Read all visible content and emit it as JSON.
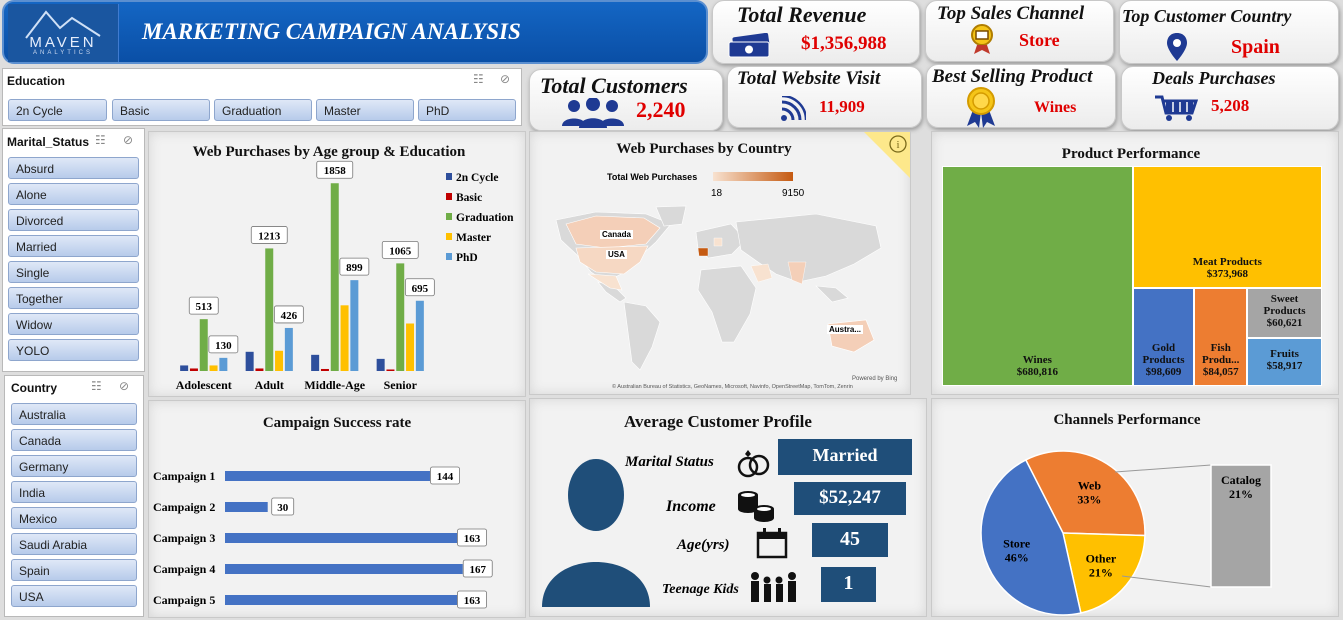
{
  "header": {
    "logo_text": "MAVEN",
    "logo_sub": "ANALYTICS",
    "title": "MARKETING CAMPAIGN ANALYSIS"
  },
  "kpis": {
    "total_revenue": {
      "label": "Total Revenue",
      "value": "$1,356,988",
      "icon": "money-icon"
    },
    "top_sales_channel": {
      "label": "Top Sales Channel",
      "value": "Store",
      "icon": "store-icon"
    },
    "top_customer_country": {
      "label": "Top Customer Country",
      "value": "Spain",
      "icon": "location-pin-icon"
    },
    "total_customers": {
      "label": "Total Customers",
      "value": "2,240",
      "icon": "people-icon"
    },
    "total_website_visit": {
      "label": "Total Website Visit",
      "value": "11,909",
      "icon": "wifi-icon"
    },
    "best_selling_product": {
      "label": "Best Selling Product",
      "value": "Wines",
      "icon": "award-icon"
    },
    "deals_purchases": {
      "label": "Deals Purchases",
      "value": "5,208",
      "icon": "cart-icon"
    }
  },
  "slicers": {
    "education": {
      "title": "Education",
      "items": [
        "2n Cycle",
        "Basic",
        "Graduation",
        "Master",
        "PhD"
      ]
    },
    "marital_status": {
      "title": "Marital_Status",
      "items": [
        "Absurd",
        "Alone",
        "Divorced",
        "Married",
        "Single",
        "Together",
        "Widow",
        "YOLO"
      ]
    },
    "country": {
      "title": "Country",
      "items": [
        "Australia",
        "Canada",
        "Germany",
        "India",
        "Mexico",
        "Saudi Arabia",
        "Spain",
        "USA"
      ]
    }
  },
  "map": {
    "title": "Web Purchases by Country",
    "legend_title": "Total Web Purchases",
    "legend_min": "18",
    "legend_max": "9150",
    "labels": [
      "Canada",
      "USA",
      "Austra..."
    ],
    "powered": "Powered by Bing",
    "credits": "© Australian Bureau of Statistics, GeoNames, Microsoft, Navinfo, OpenStreetMap, TomTom, Zenrin"
  },
  "profile": {
    "title": "Average Customer Profile",
    "rows": [
      {
        "label": "Marital Status",
        "value": "Married",
        "icon": "rings-icon"
      },
      {
        "label": "Income",
        "value": "$52,247",
        "icon": "coins-icon"
      },
      {
        "label": "Age(yrs)",
        "value": "45",
        "icon": "calendar-icon"
      },
      {
        "label": "Teenage Kids",
        "value": "1",
        "icon": "family-icon"
      }
    ]
  },
  "chart_data": [
    {
      "type": "bar",
      "title": "Web Purchases by Age group & Education",
      "categories": [
        "Adolescent",
        "Adult",
        "Middle-Age",
        "Senior"
      ],
      "series": [
        {
          "name": "2n Cycle",
          "color": "#2e4f9c",
          "values": [
            55,
            190,
            160,
            120
          ]
        },
        {
          "name": "Basic",
          "color": "#c00000",
          "values": [
            25,
            25,
            20,
            15
          ]
        },
        {
          "name": "Graduation",
          "color": "#70ad47",
          "values": [
            513,
            1213,
            1858,
            1065
          ]
        },
        {
          "name": "Master",
          "color": "#ffc000",
          "values": [
            55,
            200,
            650,
            470
          ]
        },
        {
          "name": "PhD",
          "color": "#5b9bd5",
          "values": [
            130,
            426,
            899,
            695
          ]
        }
      ],
      "data_labels": {
        "Graduation": [
          513,
          1213,
          1858,
          1065
        ],
        "PhD": [
          130,
          426,
          899,
          695
        ]
      },
      "ylim": [
        0,
        1900
      ],
      "legend": "right"
    },
    {
      "type": "treemap",
      "title": "Product Performance",
      "items": [
        {
          "name": "Wines",
          "value": 680816,
          "label": "$680,816",
          "color": "#70ad47"
        },
        {
          "name": "Meat Products",
          "value": 373968,
          "label": "$373,968",
          "color": "#ffc000"
        },
        {
          "name": "Gold Products",
          "value": 98609,
          "label": "$98,609",
          "color": "#4472c4"
        },
        {
          "name": "Fish Produ...",
          "value": 84057,
          "label": "$84,057",
          "color": "#ed7d31"
        },
        {
          "name": "Sweet Products",
          "value": 60621,
          "label": "$60,621",
          "color": "#a5a5a5"
        },
        {
          "name": "Fruits",
          "value": 58917,
          "label": "$58,917",
          "color": "#5b9bd5"
        }
      ]
    },
    {
      "type": "bar",
      "orientation": "horizontal",
      "title": "Campaign Success rate",
      "categories": [
        "Campaign 1",
        "Campaign 2",
        "Campaign 3",
        "Campaign 4",
        "Campaign 5"
      ],
      "values": [
        144,
        30,
        163,
        167,
        163
      ],
      "color": "#4472c4",
      "xlim": [
        0,
        170
      ]
    },
    {
      "type": "pie",
      "title": "Channels Performance",
      "slices": [
        {
          "name": "Web",
          "value": 33,
          "label": "33%",
          "color": "#ed7d31"
        },
        {
          "name": "Other",
          "value": 21,
          "label": "21%",
          "color": "#ffc000"
        },
        {
          "name": "Store",
          "value": 46,
          "label": "46%",
          "color": "#4472c4"
        }
      ],
      "breakout": {
        "name": "Catalog",
        "value": 21,
        "label": "21%",
        "color": "#a5a5a5"
      }
    }
  ]
}
